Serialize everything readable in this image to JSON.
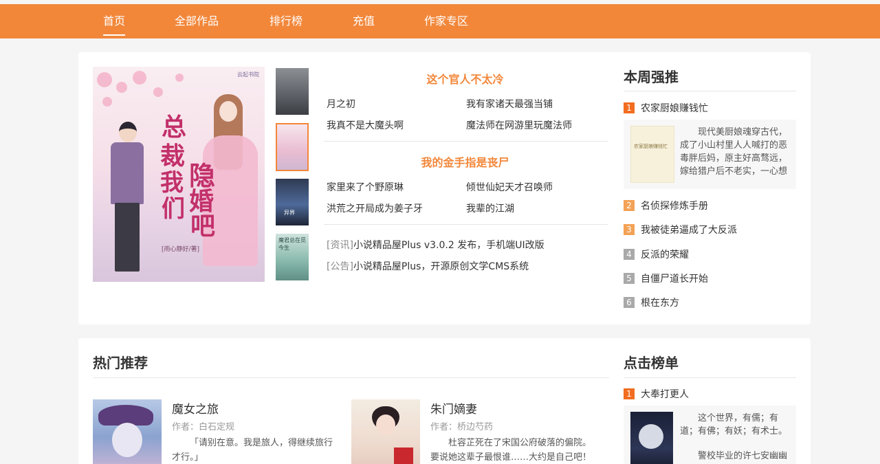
{
  "nav": {
    "items": [
      {
        "label": "首页",
        "active": true
      },
      {
        "label": "全部作品"
      },
      {
        "label": "排行榜"
      },
      {
        "label": "充值"
      },
      {
        "label": "作家专区"
      }
    ]
  },
  "featured": {
    "main_cover": {
      "title_chars": [
        "总",
        "裁",
        "我",
        "们",
        "隐",
        "婚",
        "吧"
      ],
      "author_tag": "[雨心静好/著]",
      "logo_tag": "云起书院"
    },
    "thumbs": [
      {
        "icon": "book-cover-gray"
      },
      {
        "icon": "book-cover-pink",
        "active": true
      },
      {
        "icon": "book-cover-blue",
        "mini": "异界"
      },
      {
        "icon": "book-cover-teal",
        "mini": "魔君总在觅今生"
      }
    ],
    "groups": [
      {
        "title": "这个官人不太冷",
        "links": [
          "月之初",
          "我有家诸天最强当铺",
          "我真不是大魔头啊",
          "魔法师在网游里玩魔法师"
        ]
      },
      {
        "title": "我的金手指是丧尸",
        "links": [
          "家里来了个野原琳",
          "倾世仙妃天才召唤师",
          "洪荒之开局成为姜子牙",
          "我辈的江湖"
        ]
      }
    ],
    "news": [
      {
        "tag": "[资讯]",
        "text": "小说精品屋Plus v3.0.2 发布，手机端UI改版"
      },
      {
        "tag": "[公告]",
        "text": "小说精品屋Plus，开源原创文学CMS系统"
      }
    ]
  },
  "weekly": {
    "title": "本周强推",
    "top": {
      "num": "1",
      "name": "农家厨娘赚钱忙",
      "cover_text": "农家厨娘赚钱忙",
      "desc": "现代美厨娘魂穿古代，成了小山村里人人喊打的恶毒胖后妈，原主好高骛远，嫁给猎户后不老实，一心想要"
    },
    "items": [
      {
        "num": "2",
        "name": "名侦探修炼手册"
      },
      {
        "num": "3",
        "name": "我被徒弟逼成了大反派"
      },
      {
        "num": "4",
        "name": "反派的荣耀"
      },
      {
        "num": "5",
        "name": "自僵尸道长开始"
      },
      {
        "num": "6",
        "name": "根在东方"
      }
    ]
  },
  "hot": {
    "title": "热门推荐",
    "books": [
      {
        "name": "魔女之旅",
        "author": "作者：白石定规",
        "desc": "「请别在意。我是旅人，得继续旅行才行。」"
      },
      {
        "name": "朱门嫡妻",
        "author": "作者：桥边芍药",
        "desc": "杜容芷死在了宋国公府破落的偏院。要说她这辈子最恨谁……大约是自己吧！那个"
      }
    ]
  },
  "clicks": {
    "title": "点击榜单",
    "top": {
      "num": "1",
      "name": "大奉打更人",
      "desc1": "这个世界，有儒；有道；有佛；有妖；有术士。",
      "desc2": "警校毕业的许七安幽幽醒"
    }
  },
  "colors": {
    "accent": "#f2873a",
    "rank_hot": "#f26d1f",
    "rank_warm": "#f3a256",
    "rank_gray": "#a9a9a9"
  }
}
